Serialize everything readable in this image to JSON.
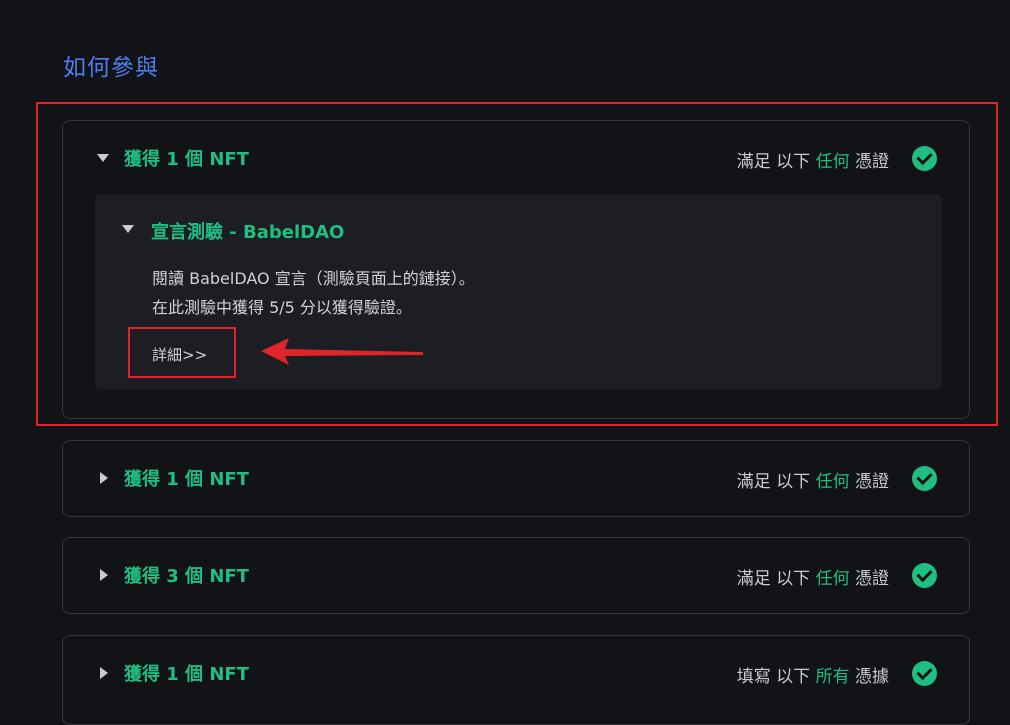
{
  "section": {
    "title": "如何參與"
  },
  "cards": [
    {
      "title": "獲得 1 個 NFT",
      "cond_pre": "滿足 以下 ",
      "cond_hl": "任何",
      "cond_post": " 憑證",
      "expanded": true,
      "inner": {
        "title": "宣言測驗 - BabelDAO",
        "line1": "閱讀 BabelDAO 宣言（測驗頁面上的鏈接）。",
        "line2": "在此測驗中獲得 5/5 分以獲得驗證。",
        "details": "詳細>>"
      }
    },
    {
      "title": "獲得 1 個 NFT",
      "cond_pre": "滿足 以下 ",
      "cond_hl": "任何",
      "cond_post": " 憑證",
      "expanded": false
    },
    {
      "title": "獲得 3 個 NFT",
      "cond_pre": "滿足 以下 ",
      "cond_hl": "任何",
      "cond_post": " 憑證",
      "expanded": false
    },
    {
      "title": "獲得 1 個 NFT",
      "cond_pre": "填寫 以下 ",
      "cond_hl": "所有",
      "cond_post": " 憑據",
      "expanded": false
    }
  ],
  "colors": {
    "accent_green": "#1fbe83",
    "title_blue": "#4f7df0",
    "annotation_red": "#e0252a"
  }
}
